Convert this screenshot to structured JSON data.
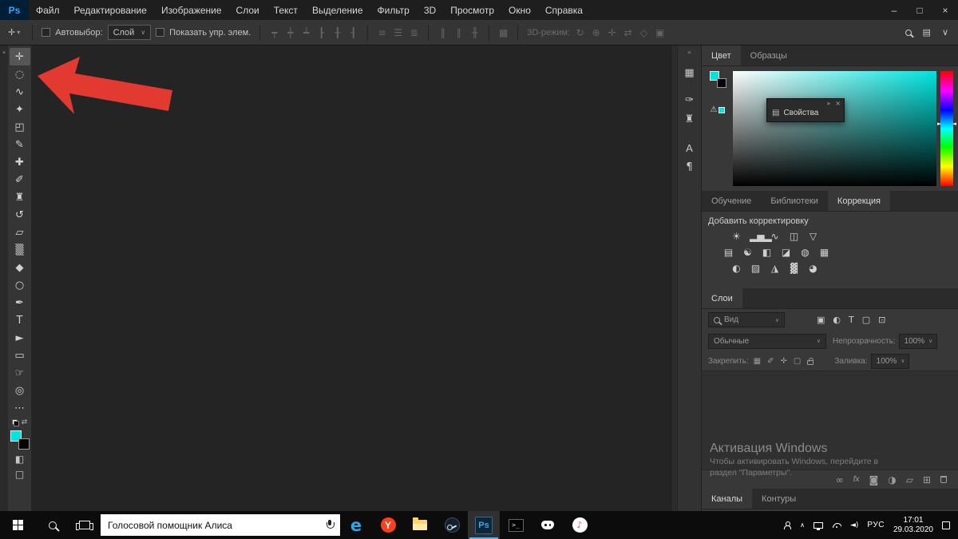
{
  "colors": {
    "ps_blue": "#31a8ff",
    "foreground": "#00e4df",
    "arrow_red": "#e23a30"
  },
  "menu_bar": {
    "logo": "Ps",
    "items": [
      "Файл",
      "Редактирование",
      "Изображение",
      "Слои",
      "Текст",
      "Выделение",
      "Фильтр",
      "3D",
      "Просмотр",
      "Окно",
      "Справка"
    ],
    "minimize": "–",
    "maximize": "□",
    "close": "×"
  },
  "options_bar": {
    "tool_glyph": "✛",
    "tool_caret": "▾",
    "autoselect_label": "Автовыбор:",
    "autoselect_value": "Слой",
    "select_caret": "∨",
    "show_controls_label": "Показать упр. элем.",
    "align_icons": [
      "┯",
      "┿",
      "┷",
      "┠",
      "╂",
      "┨"
    ],
    "distribute_icons": [
      "≡",
      "☰",
      "≣"
    ],
    "spacing_icons": [
      "‖",
      "∥",
      "╫"
    ],
    "auto_align_icon": "▦",
    "mode3d_label": "3D-режим:",
    "mode3d_icons": [
      "↻",
      "⊕",
      "✛",
      "⇄",
      "◇",
      "▣"
    ],
    "workspace_icon": "▤"
  },
  "toolbar": {
    "expand_icon": "»",
    "tools": [
      {
        "name": "move",
        "glyph": "✛"
      },
      {
        "name": "marquee",
        "glyph": "◌"
      },
      {
        "name": "lasso",
        "glyph": "∿"
      },
      {
        "name": "quick-selection",
        "glyph": "✦"
      },
      {
        "name": "crop",
        "glyph": "◰"
      },
      {
        "name": "eyedropper",
        "glyph": "✎"
      },
      {
        "name": "healing-brush",
        "glyph": "✚"
      },
      {
        "name": "brush",
        "glyph": "✐"
      },
      {
        "name": "clone-stamp",
        "glyph": "♜"
      },
      {
        "name": "history-brush",
        "glyph": "↺"
      },
      {
        "name": "eraser",
        "glyph": "▱"
      },
      {
        "name": "gradient",
        "glyph": "▒"
      },
      {
        "name": "blur",
        "glyph": "◆"
      },
      {
        "name": "dodge",
        "glyph": "○"
      },
      {
        "name": "pen",
        "glyph": "✒"
      },
      {
        "name": "type",
        "glyph": "T"
      },
      {
        "name": "path-selection",
        "glyph": "►"
      },
      {
        "name": "rectangle",
        "glyph": "▭"
      },
      {
        "name": "hand",
        "glyph": "☞"
      },
      {
        "name": "zoom",
        "glyph": "◎"
      },
      {
        "name": "edit-toolbar",
        "glyph": "⋯"
      }
    ],
    "swap_icon": "⇄",
    "quick_mask_icon": "◧",
    "screen_mode_icon": "□"
  },
  "dock_strip": {
    "collapse_icon": "«",
    "icons": [
      {
        "name": "properties",
        "glyph": "▦"
      },
      {
        "name": "brush-settings",
        "glyph": "✑"
      },
      {
        "name": "clone-source",
        "glyph": "♜"
      },
      {
        "name": "character",
        "glyph": "A"
      },
      {
        "name": "paragraph",
        "glyph": "¶"
      }
    ]
  },
  "color_panel": {
    "tabs": [
      "Цвет",
      "Образцы"
    ],
    "properties_tooltip": {
      "collapse": "»",
      "close": "×",
      "icon": "▤",
      "label": "Свойства"
    },
    "warning_icon": "⚠",
    "slider_left": "►",
    "slider_right": "◄"
  },
  "adjustments_panel": {
    "tabs": [
      "Обучение",
      "Библиотеки",
      "Коррекция"
    ],
    "header": "Добавить корректировку",
    "row1": [
      {
        "name": "brightness-contrast",
        "glyph": "☀"
      },
      {
        "name": "levels",
        "glyph": "▂▅▂"
      },
      {
        "name": "curves",
        "glyph": "∿"
      },
      {
        "name": "exposure",
        "glyph": "◫"
      },
      {
        "name": "vibrance",
        "glyph": "▽"
      }
    ],
    "row2": [
      {
        "name": "hue-saturation",
        "glyph": "▤"
      },
      {
        "name": "color-balance",
        "glyph": "☯"
      },
      {
        "name": "black-white",
        "glyph": "◧"
      },
      {
        "name": "photo-filter",
        "glyph": "◪"
      },
      {
        "name": "channel-mixer",
        "glyph": "◍"
      },
      {
        "name": "color-lookup",
        "glyph": "▦"
      }
    ],
    "row3": [
      {
        "name": "invert",
        "glyph": "◐"
      },
      {
        "name": "posterize",
        "glyph": "▨"
      },
      {
        "name": "threshold",
        "glyph": "◮"
      },
      {
        "name": "gradient-map",
        "glyph": "▓"
      },
      {
        "name": "selective-color",
        "glyph": "◕"
      }
    ]
  },
  "layers_panel": {
    "tab": "Слои",
    "filter_label": "Вид",
    "caret": "∨",
    "type_icons": [
      {
        "name": "filter-pixel-layers",
        "glyph": "▣"
      },
      {
        "name": "filter-adjustment-layers",
        "glyph": "◐"
      },
      {
        "name": "filter-type-layers",
        "glyph": "T"
      },
      {
        "name": "filter-shape-layers",
        "glyph": "▢"
      },
      {
        "name": "filter-smart-objects",
        "glyph": "⊡"
      }
    ],
    "blend_mode": "Обычные",
    "opacity_label": "Непрозрачность:",
    "opacity_value": "100%",
    "lock_label": "Закрепить:",
    "lock_icons": [
      {
        "name": "lock-transparent-pixels",
        "glyph": "▦"
      },
      {
        "name": "lock-image-pixels",
        "glyph": "✐"
      },
      {
        "name": "lock-position",
        "glyph": "✛"
      },
      {
        "name": "lock-artboard",
        "glyph": "▢"
      }
    ],
    "fill_label": "Заливка:",
    "fill_value": "100%",
    "bottom_icons": [
      {
        "name": "link-layers",
        "glyph": "∞"
      },
      {
        "name": "layer-effects",
        "glyph": "fx"
      },
      {
        "name": "layer-mask",
        "glyph": "◙"
      },
      {
        "name": "adjustment-layer",
        "glyph": "◑"
      },
      {
        "name": "layer-group",
        "glyph": "▱"
      },
      {
        "name": "new-layer",
        "glyph": "⊞"
      }
    ]
  },
  "activation": {
    "title": "Активация Windows",
    "line1": "Чтобы активировать Windows, перейдите в",
    "line2": "раздел \"Параметры\"."
  },
  "channels_panel": {
    "tabs": [
      "Каналы",
      "Контуры"
    ]
  },
  "taskbar": {
    "search_text": "Голосовой помощник Алиса",
    "apps": [
      {
        "name": "edge",
        "glyph": "e"
      },
      {
        "name": "yandex-browser",
        "glyph": "Y"
      },
      {
        "name": "photoshop",
        "glyph": "Ps"
      },
      {
        "name": "terminal",
        "glyph": "&gt;_"
      },
      {
        "name": "itunes",
        "glyph": "♪"
      }
    ],
    "tray": {
      "chevron": "∧",
      "volume": "◄)",
      "language": "РУС",
      "time": "17:01",
      "date": "29.03.2020"
    }
  }
}
